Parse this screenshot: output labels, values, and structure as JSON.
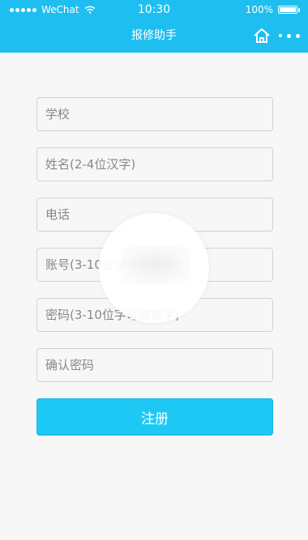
{
  "status_bar": {
    "carrier": "WeChat",
    "time": "10:30",
    "battery": "100%"
  },
  "nav": {
    "title": "报修助手"
  },
  "form": {
    "fields": [
      {
        "placeholder": "学校"
      },
      {
        "placeholder": "姓名(2-4位汉字)"
      },
      {
        "placeholder": "电话"
      },
      {
        "placeholder": "账号(3-10位字母或数字)"
      },
      {
        "placeholder": "密码(3-10位字母或数字)"
      },
      {
        "placeholder": "确认密码"
      }
    ],
    "submit_label": "注册"
  },
  "colors": {
    "header": "#1fbef0",
    "button": "#1ec8f5",
    "background": "#f7f7f7"
  }
}
